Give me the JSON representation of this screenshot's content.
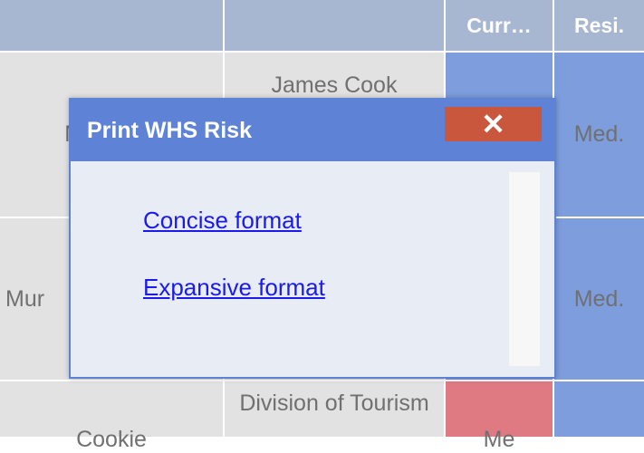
{
  "table": {
    "headers": {
      "col3": "Curr…",
      "col4": "Resi."
    },
    "rows": [
      {
        "c1": "Me",
        "c2": "James Cook",
        "c4": "Med."
      },
      {
        "c1": "Mur",
        "c2": "",
        "c4": "Med."
      },
      {
        "c1": "Cookie",
        "c2": "Division of Tourism",
        "c3": "Me"
      }
    ]
  },
  "dialog": {
    "title": "Print WHS Risk",
    "close_symbol": "✕",
    "links": [
      "Concise format",
      "Expansive format"
    ]
  },
  "colors": {
    "header": "#a7b7d1",
    "dialog_header": "#5e83d6",
    "close": "#c8573e",
    "risk_blue": "#7d9ddd",
    "risk_red": "#e07a82"
  }
}
